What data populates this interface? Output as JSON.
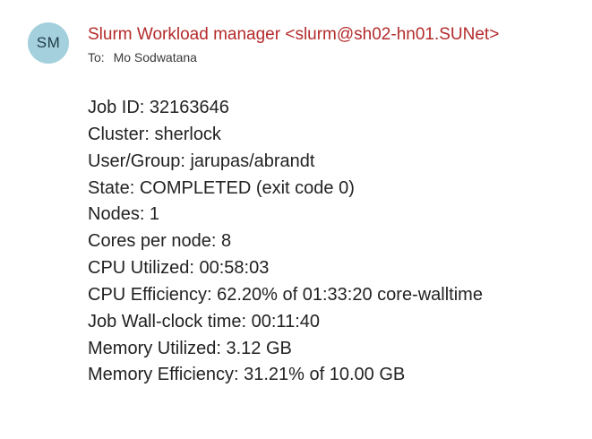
{
  "avatar": {
    "initials": "SM"
  },
  "sender": "Slurm Workload manager <slurm@sh02-hn01.SUNet>",
  "to": {
    "label": "To:",
    "name": "Mo Sodwatana"
  },
  "colors": {
    "sender": "#b52b2b",
    "avatar_bg": "#a3d0dc",
    "body_text": "#222222"
  },
  "body_lines": [
    "Job ID: 32163646",
    "Cluster: sherlock",
    "User/Group: jarupas/abrandt",
    "State: COMPLETED (exit code 0)",
    "Nodes: 1",
    "Cores per node: 8",
    "CPU Utilized: 00:58:03",
    "CPU Efficiency: 62.20% of 01:33:20 core-walltime",
    "Job Wall-clock time: 00:11:40",
    "Memory Utilized: 3.12 GB",
    "Memory Efficiency: 31.21% of 10.00 GB"
  ]
}
